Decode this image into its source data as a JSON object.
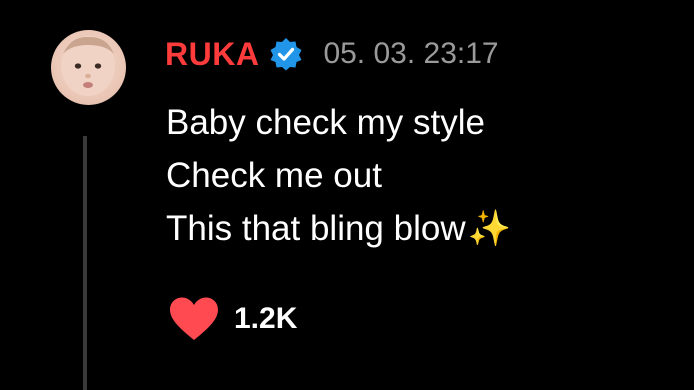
{
  "post": {
    "username": "RUKA",
    "timestamp": "05. 03. 23:17",
    "lines": [
      "Baby check my style",
      "Check me out",
      "This that bling blow"
    ],
    "line3_emoji": "✨",
    "like_count": "1.2K"
  },
  "colors": {
    "background": "#000000",
    "username": "#ff3b3b",
    "verified_badge": "#2196e8",
    "timestamp": "#9a9a9a",
    "heart": "#ff4a52",
    "thread_line": "#3a3a3a"
  },
  "icons": {
    "verified": "verified-badge-icon",
    "like": "heart-icon"
  }
}
